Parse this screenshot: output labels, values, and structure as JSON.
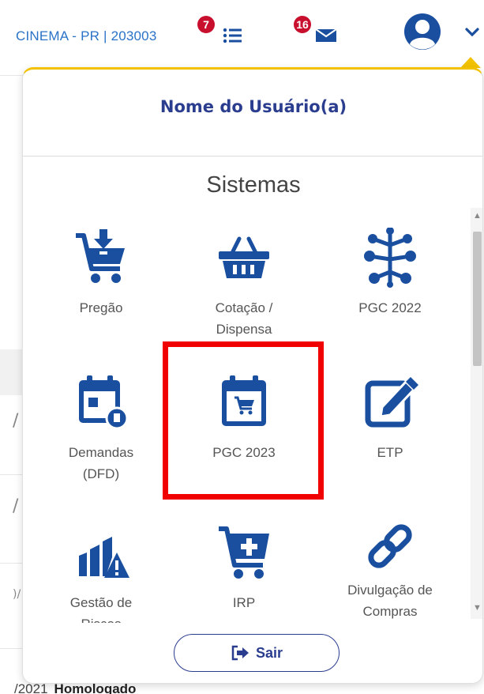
{
  "header": {
    "unit_label": "CINEMA - PR | 203003",
    "tasks_badge": "7",
    "messages_badge": "16"
  },
  "background": {
    "bottom_row_date": "/2021",
    "bottom_row_status": "Homologado"
  },
  "menu": {
    "user_name": "Nome do Usuário(a)",
    "section_title": "Sistemas",
    "items": [
      {
        "label": "Pregão",
        "icon": "cart-download-icon"
      },
      {
        "label": "Cotação / Dispensa",
        "icon": "basket-icon"
      },
      {
        "label": "PGC 2022",
        "icon": "network-icon"
      },
      {
        "label": "Demandas (DFD)",
        "icon": "calendar-clock-icon"
      },
      {
        "label": "PGC 2023",
        "icon": "calendar-cart-icon"
      },
      {
        "label": "ETP",
        "icon": "edit-square-icon"
      },
      {
        "label": "Gestão de Riscos",
        "icon": "risk-chart-icon"
      },
      {
        "label": "IRP",
        "icon": "cart-plus-icon"
      },
      {
        "label": "Divulgação de Compras",
        "icon": "link-icon"
      }
    ],
    "logout_label": "Sair"
  },
  "colors": {
    "brand_blue": "#2b3d8f",
    "icon_blue": "#1a4fa0",
    "badge_red": "#c8102e",
    "accent_yellow": "#f2c200",
    "highlight_red": "#f00000"
  }
}
